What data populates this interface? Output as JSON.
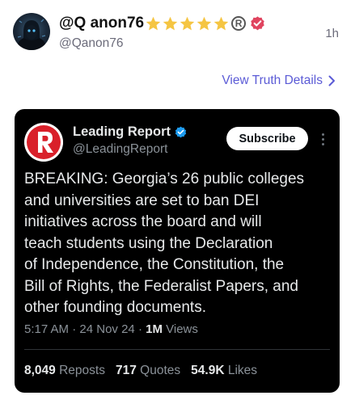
{
  "post": {
    "display_name": "@Q anon76",
    "handle": "@Qanon76",
    "time": "1h",
    "star_count": 5,
    "reg_symbol": "R",
    "view_details_label": "View Truth Details",
    "icons": [
      "avatar",
      "star-icon",
      "registered-icon",
      "verified-badge-icon",
      "chevron-right-icon"
    ]
  },
  "embedded_tweet": {
    "logo_icon": "leading-report-logo",
    "author_name": "Leading Report",
    "author_handle": "@LeadingReport",
    "subscribe_label": "Subscribe",
    "text": "BREAKING: Georgia’s 26 public colleges\nand universities are set to ban DEI\ninitiatives across the board and will\nteach students using the Declaration\nof Independence, the Constitution, the\nBill of Rights, the Federalist Papers, and\nother founding documents.",
    "time": "5:17 AM",
    "date": "24 Nov 24",
    "views_count": "1M",
    "views_label": "Views",
    "meta_sep": "·",
    "stats": [
      {
        "num": "8,049",
        "label": "Reposts"
      },
      {
        "num": "717",
        "label": "Quotes"
      },
      {
        "num": "54.9K",
        "label": "Likes"
      }
    ]
  },
  "colors": {
    "star": "#f5c542",
    "truth_verified": "#e0445f",
    "link": "#5b5bd6",
    "card_bg": "#000000",
    "x_verified": "#1d9bf0",
    "brand_red": "#d9202a"
  }
}
